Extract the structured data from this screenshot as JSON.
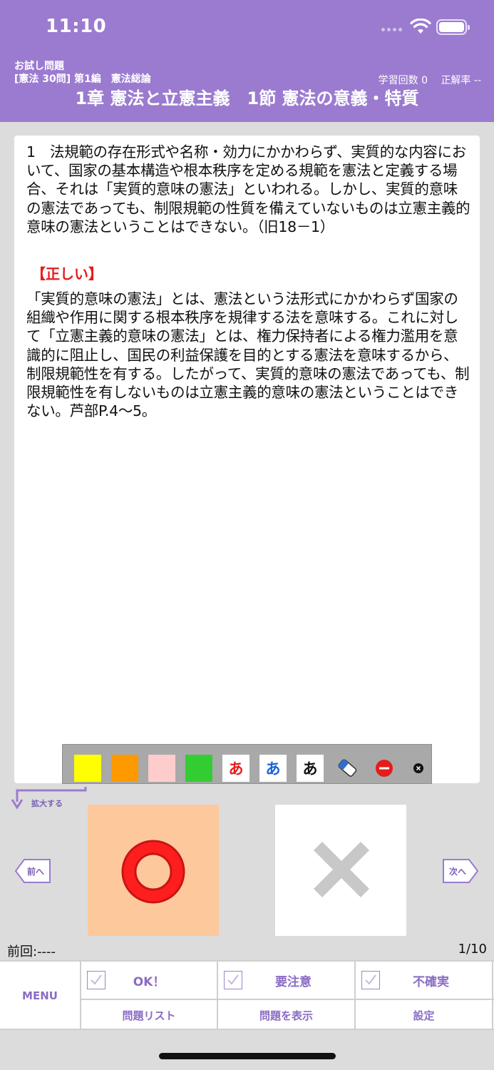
{
  "status_bar": {
    "time": "11:10"
  },
  "header": {
    "trial_label": "お試し問題",
    "chapter_label": "[憲法 30問] 第1編　憲法総論",
    "study_count": "学習回数 0",
    "accuracy": "正解率 --",
    "title": "1章 憲法と立憲主義　1節 憲法の意義・特質"
  },
  "question": {
    "text": "1　法規範の存在形式や名称・効力にかかわらず、実質的な内容において、国家の基本構造や根本秩序を定める規範を憲法と定義する場合、それは「実質的意味の憲法」といわれる。しかし、実質的意味の憲法であっても、制限規範の性質を備えていないものは立憲主義的意味の憲法ということはできない。（旧18－1）",
    "answer_label": "【正しい】",
    "explanation": "「実質的意味の憲法」とは、憲法という法形式にかかわらず国家の組織や作用に関する根本秩序を規律する法を意味する。これに対して「立憲主義的意味の憲法」とは、権力保持者による権力濫用を意識的に阻止し、国民の利益保護を目的とする憲法を意味するから、制限規範性を有する。したがって、実質的意味の憲法であっても、制限規範性を有しないものは立憲主義的意味の憲法ということはできない。芦部P.4〜5。"
  },
  "toolbar": {
    "colors": {
      "yellow": "#ffff00",
      "orange": "#ff9900",
      "pink": "#ffcccc",
      "green": "#33cc33"
    },
    "text_red": "あ",
    "text_blue": "あ",
    "text_black": "あ"
  },
  "expand_label": "拡大する",
  "nav": {
    "prev": "前へ",
    "next": "次へ"
  },
  "footer": {
    "last_result": "前回:----",
    "progress": "1/10",
    "menu": "MENU",
    "ok": "OK！",
    "caution": "要注意",
    "uncertain": "不確実",
    "question_list": "問題リスト",
    "show_question": "問題を表示",
    "settings": "設定"
  }
}
